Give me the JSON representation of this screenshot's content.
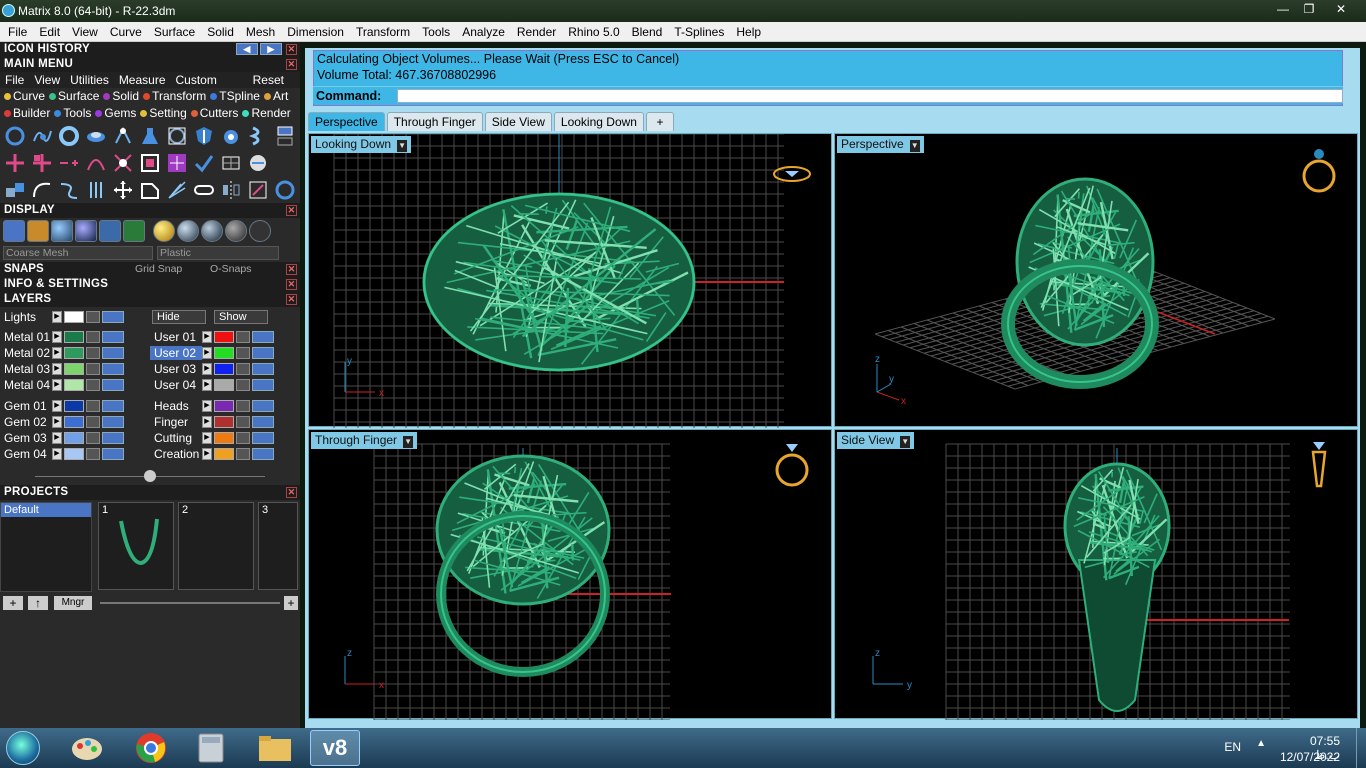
{
  "window": {
    "title": "Matrix 8.0 (64-bit) - R-22.3dm"
  },
  "menubar": [
    "File",
    "Edit",
    "View",
    "Curve",
    "Surface",
    "Solid",
    "Mesh",
    "Dimension",
    "Transform",
    "Tools",
    "Analyze",
    "Render",
    "Rhino 5.0",
    "Blend",
    "T-Splines",
    "Help"
  ],
  "left": {
    "icon_history": "ICON HISTORY",
    "main_menu": "MAIN MENU",
    "main_menu_items": [
      "File",
      "View",
      "Utilities",
      "Measure",
      "Custom"
    ],
    "reset": "Reset",
    "categories_row1": [
      "Curve",
      "Surface",
      "Solid",
      "Transform",
      "TSpline",
      "Art"
    ],
    "categories_row2": [
      "Builder",
      "Tools",
      "Gems",
      "Setting",
      "Cutters",
      "Render"
    ],
    "display": "DISPLAY",
    "coarse_mesh": "Coarse Mesh",
    "plastic": "Plastic",
    "snaps": "SNAPS",
    "grid_snap": "Grid Snap",
    "o_snaps": "O-Snaps",
    "info_settings": "INFO & SETTINGS",
    "layers": "LAYERS",
    "lights": "Lights",
    "hide": "Hide",
    "show": "Show",
    "layers_left": [
      {
        "name": "Metal 01",
        "color": "#1a7a4a"
      },
      {
        "name": "Metal 02",
        "color": "#2e9a5e"
      },
      {
        "name": "Metal 03",
        "color": "#7ed36c"
      },
      {
        "name": "Metal 04",
        "color": "#b0e7a8"
      },
      {
        "name": "Gem 01",
        "color": "#0b3aa8"
      },
      {
        "name": "Gem 02",
        "color": "#3b6fd4"
      },
      {
        "name": "Gem 03",
        "color": "#6fa0e8"
      },
      {
        "name": "Gem 04",
        "color": "#a7c8f4"
      }
    ],
    "layers_right": [
      {
        "name": "User 01",
        "color": "#ee1111"
      },
      {
        "name": "User 02",
        "color": "#22dd22"
      },
      {
        "name": "User 03",
        "color": "#1122ee"
      },
      {
        "name": "User 04",
        "color": "#aaaaaa"
      },
      {
        "name": "Heads",
        "color": "#7a2ab0"
      },
      {
        "name": "Finger",
        "color": "#b03030"
      },
      {
        "name": "Cutting",
        "color": "#ee7a10"
      },
      {
        "name": "Creation",
        "color": "#f0a020"
      }
    ],
    "projects": "PROJECTS",
    "project_default": "Default",
    "thumb_numbers": [
      "1",
      "2",
      "3"
    ],
    "mngr": "Mngr"
  },
  "command": {
    "line1": "Calculating Object Volumes... Please Wait (Press ESC to Cancel)",
    "line2": "Volume Total: 467.36708802996",
    "prompt": "Command:"
  },
  "tabs": [
    "Perspective",
    "Through Finger",
    "Side View",
    "Looking Down",
    "+"
  ],
  "viewports": {
    "tl": "Looking Down",
    "tr": "Perspective",
    "bl": "Through Finger",
    "br": "Side View"
  },
  "axes": {
    "x": "x",
    "y": "y",
    "z": "z"
  },
  "taskbar": {
    "lang": "EN",
    "time": "07:55 ب.ظ",
    "date": "12/07/2022",
    "app_label": "v8"
  },
  "colors": {
    "ring": "#1e8a5e",
    "grid": "#555555",
    "accent": "#3fb7e6",
    "axis_red": "#cc2222",
    "axis_blue": "#2a8ac0"
  }
}
